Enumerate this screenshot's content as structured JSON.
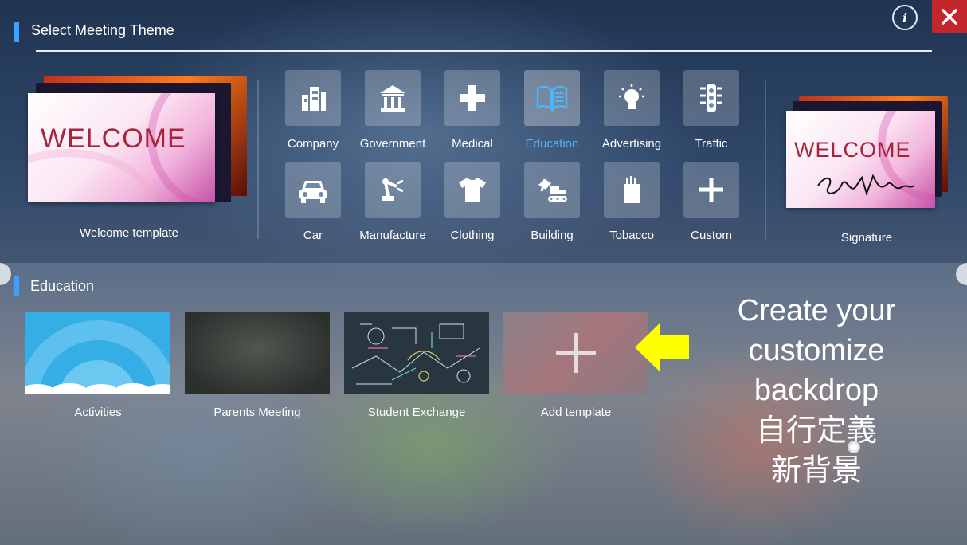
{
  "header": {
    "title": "Select Meeting Theme"
  },
  "controls": {
    "info_glyph": "i",
    "close_glyph": "✕"
  },
  "left_template": {
    "label": "Welcome template",
    "card_text": "WELCOME"
  },
  "right_template": {
    "label": "Signature",
    "card_text": "WELCOME"
  },
  "categories": [
    {
      "label": "Company",
      "icon": "building-icon",
      "active": false
    },
    {
      "label": "Government",
      "icon": "government-icon",
      "active": false
    },
    {
      "label": "Medical",
      "icon": "medical-cross-icon",
      "active": false
    },
    {
      "label": "Education",
      "icon": "book-icon",
      "active": true
    },
    {
      "label": "Advertising",
      "icon": "lightbulb-icon",
      "active": false
    },
    {
      "label": "Traffic",
      "icon": "traffic-light-icon",
      "active": false
    },
    {
      "label": "Car",
      "icon": "car-icon",
      "active": false
    },
    {
      "label": "Manufacture",
      "icon": "robot-arm-icon",
      "active": false
    },
    {
      "label": "Clothing",
      "icon": "tshirt-icon",
      "active": false
    },
    {
      "label": "Building",
      "icon": "excavator-icon",
      "active": false
    },
    {
      "label": "Tobacco",
      "icon": "cigarette-pack-icon",
      "active": false
    },
    {
      "label": "Custom",
      "icon": "plus-icon",
      "active": false
    }
  ],
  "section": {
    "title": "Education"
  },
  "templates": [
    {
      "label": "Activities"
    },
    {
      "label": "Parents Meeting"
    },
    {
      "label": "Student Exchange"
    },
    {
      "label": "Add template"
    }
  ],
  "annotation": {
    "lines": [
      "Create your",
      "customize",
      "backdrop",
      "自行定義",
      "新背景"
    ],
    "arrow_color": "#ffff00"
  },
  "colors": {
    "accent": "#3da2ff",
    "close": "#c4262e",
    "active_text": "#4fb4ff"
  }
}
